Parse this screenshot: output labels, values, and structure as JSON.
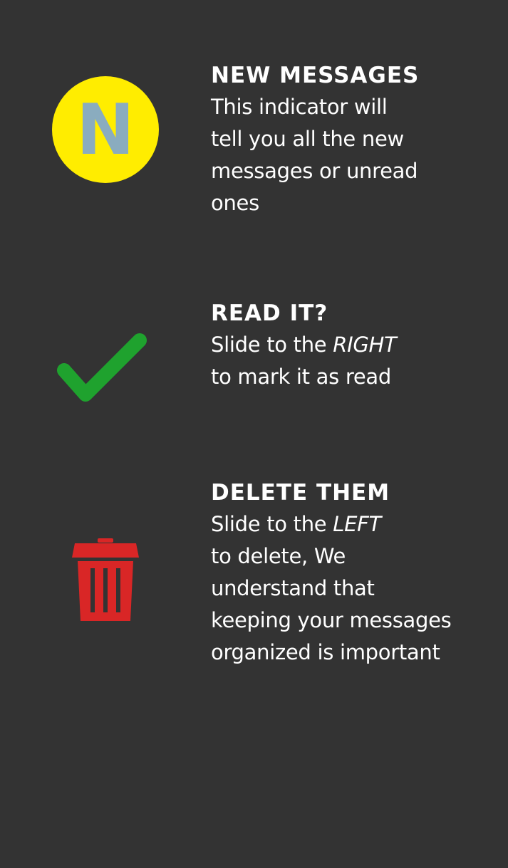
{
  "sections": [
    {
      "icon": "new-messages-badge-icon",
      "badge_letter": "N",
      "title": "NEW MESSAGES",
      "lines": [
        "This indicator will",
        "tell you all the new",
        "messages or unread",
        "ones"
      ]
    },
    {
      "icon": "checkmark-icon",
      "title": "READ IT?",
      "line1_prefix": "Slide to the ",
      "line1_emphasis": "RIGHT",
      "line2": "to mark it as read"
    },
    {
      "icon": "trash-icon",
      "title": "DELETE THEM",
      "line1_prefix": "Slide to the ",
      "line1_emphasis": "LEFT",
      "lines": [
        "to delete, We",
        "understand that",
        "keeping your messages",
        "organized is important"
      ]
    }
  ],
  "colors": {
    "background": "#333333",
    "text": "#ffffff",
    "badge_fill": "#ffed00",
    "badge_letter": "#8aacbf",
    "check": "#1fa22e",
    "trash": "#d92626"
  }
}
